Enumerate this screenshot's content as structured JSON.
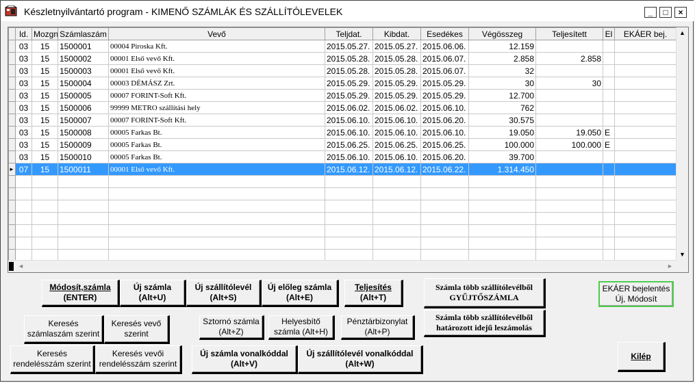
{
  "window": {
    "title": "Készletnyilvántartó program  -  KIMENŐ SZÁMLÁK ÉS SZÁLLÍTÓLEVELEK",
    "min": "_",
    "max": "□",
    "close": "×"
  },
  "grid": {
    "columns": [
      "Id.",
      "Mozgn",
      "Számlaszám",
      "Vevő",
      "Teljdat.",
      "Kibdat.",
      "Esedékes",
      "Végösszeg",
      "Teljesített",
      "El",
      "EKÁER bej."
    ],
    "rows": [
      {
        "id": "03",
        "mozgn": "15",
        "szam": "1500001",
        "vevo": "00004  Piroska Kft.",
        "telj": "2015.05.27.",
        "kib": "2015.05.27.",
        "esed": "2015.06.06.",
        "veg": "12.159",
        "teljes": "",
        "el": "",
        "ekaer": ""
      },
      {
        "id": "03",
        "mozgn": "15",
        "szam": "1500002",
        "vevo": "00001  Első vevő Kft.",
        "telj": "2015.05.28.",
        "kib": "2015.05.28.",
        "esed": "2015.06.07.",
        "veg": "2.858",
        "teljes": "2.858",
        "el": "",
        "ekaer": ""
      },
      {
        "id": "03",
        "mozgn": "15",
        "szam": "1500003",
        "vevo": "00001  Első vevő Kft.",
        "telj": "2015.05.28.",
        "kib": "2015.05.28.",
        "esed": "2015.06.07.",
        "veg": "32",
        "teljes": "",
        "el": "",
        "ekaer": ""
      },
      {
        "id": "03",
        "mozgn": "15",
        "szam": "1500004",
        "vevo": "00003  DÉMÁSZ Zrt.",
        "telj": "2015.05.29.",
        "kib": "2015.05.29.",
        "esed": "2015.05.29.",
        "veg": "30",
        "teljes": "30",
        "el": "",
        "ekaer": ""
      },
      {
        "id": "03",
        "mozgn": "15",
        "szam": "1500005",
        "vevo": "00007  FORINT-Soft Kft.",
        "telj": "2015.05.29.",
        "kib": "2015.05.29.",
        "esed": "2015.05.29.",
        "veg": "12.700",
        "teljes": "",
        "el": "",
        "ekaer": ""
      },
      {
        "id": "03",
        "mozgn": "15",
        "szam": "1500006",
        "vevo": "99999  METRO   szállítási hely",
        "telj": "2015.06.02.",
        "kib": "2015.06.02.",
        "esed": "2015.06.10.",
        "veg": "762",
        "teljes": "",
        "el": "",
        "ekaer": ""
      },
      {
        "id": "03",
        "mozgn": "15",
        "szam": "1500007",
        "vevo": "00007  FORINT-Soft Kft.",
        "telj": "2015.06.10.",
        "kib": "2015.06.10.",
        "esed": "2015.06.20.",
        "veg": "30.575",
        "teljes": "",
        "el": "",
        "ekaer": ""
      },
      {
        "id": "03",
        "mozgn": "15",
        "szam": "1500008",
        "vevo": "00005  Farkas Bt.",
        "telj": "2015.06.10.",
        "kib": "2015.06.10.",
        "esed": "2015.06.10.",
        "veg": "19.050",
        "teljes": "19.050",
        "el": "E",
        "ekaer": ""
      },
      {
        "id": "03",
        "mozgn": "15",
        "szam": "1500009",
        "vevo": "00005  Farkas Bt.",
        "telj": "2015.06.25.",
        "kib": "2015.06.25.",
        "esed": "2015.06.25.",
        "veg": "100.000",
        "teljes": "100.000",
        "el": "E",
        "ekaer": ""
      },
      {
        "id": "03",
        "mozgn": "15",
        "szam": "1500010",
        "vevo": "00005  Farkas Bt.",
        "telj": "2015.06.10.",
        "kib": "2015.06.10.",
        "esed": "2015.06.20.",
        "veg": "39.700",
        "teljes": "",
        "el": "",
        "ekaer": ""
      },
      {
        "id": "07",
        "mozgn": "15",
        "szam": "1500011",
        "vevo": "00001  Első vevő Kft.",
        "telj": "2015.06.12.",
        "kib": "2015.06.12.",
        "esed": "2015.06.22.",
        "veg": "1.314.450",
        "teljes": "",
        "el": "",
        "ekaer": "",
        "selected": true
      }
    ]
  },
  "buttons": {
    "modosit": {
      "l1": "Módosít,számla",
      "l2": "(ENTER)"
    },
    "uj_szamla": {
      "l1": "Új  számla",
      "l2": "(Alt+U)"
    },
    "uj_szallito": {
      "l1": "Új szállítólevél",
      "l2": "(Alt+S)"
    },
    "uj_eloleg": {
      "l1": "Új előleg számla",
      "l2": "(Alt+E)"
    },
    "teljesites": {
      "l1": "Teljesítés",
      "l2": "(Alt+T)"
    },
    "gyujto": {
      "l1": "Számla több szállítólevélből",
      "l2": "GYŰJTŐSZÁMLA"
    },
    "ekaer": {
      "l1": "EKÁER bejelentés",
      "l2": "Új, Módosít"
    },
    "kereses_szam": {
      "l1": "Keresés",
      "l2": "számlaszám szerint"
    },
    "kereses_vevo": {
      "l1": "Keresés vevő",
      "l2": "szerint"
    },
    "sztorno": {
      "l1": "Sztornó számla",
      "l2": "(Alt+Z)"
    },
    "helyesbito": {
      "l1": "Helyesbítő",
      "l2": "számla (Alt+H)"
    },
    "penztar": {
      "l1": "Pénztárbizonylat",
      "l2": "(Alt+P)"
    },
    "hatarozott": {
      "l1": "Számla több szállítólevélből",
      "l2": "határozott idejű leszámolás"
    },
    "kereses_rend": {
      "l1": "Keresés",
      "l2": "rendelésszám szerint"
    },
    "kereses_vevoi_rend": {
      "l1": "Keresés vevői",
      "l2": "rendelésszám szerint"
    },
    "uj_szamla_vonal": {
      "l1": "Új  számla vonalkóddal",
      "l2": "(Alt+V)"
    },
    "uj_szallito_vonal": {
      "l1": "Új szállítólevél vonalkóddal",
      "l2": "(Alt+W)"
    },
    "kilep": {
      "l1": "Kilép"
    }
  },
  "icons": {
    "up": "▲",
    "down": "▼",
    "left": "◄",
    "right": "►",
    "row_pointer": "►"
  }
}
